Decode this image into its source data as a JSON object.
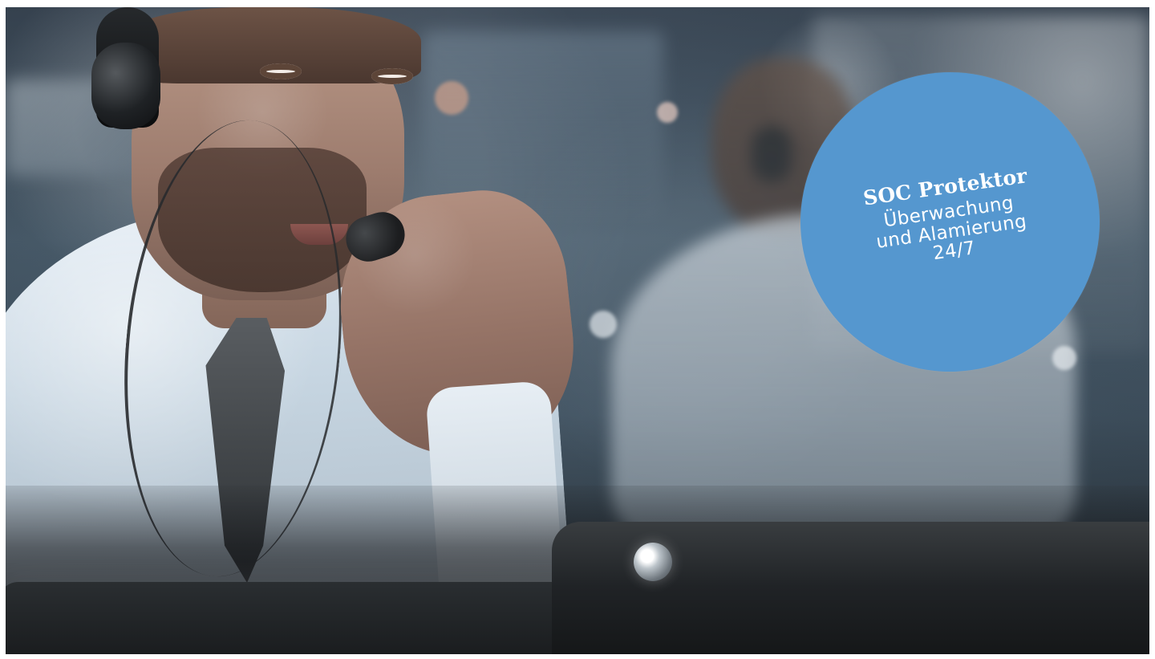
{
  "hero": {
    "badge": {
      "title": "SOC Protektor",
      "line1": "Überwachung",
      "line2": "und Alamierung",
      "line3": "24/7",
      "color": "#5597cf"
    }
  }
}
